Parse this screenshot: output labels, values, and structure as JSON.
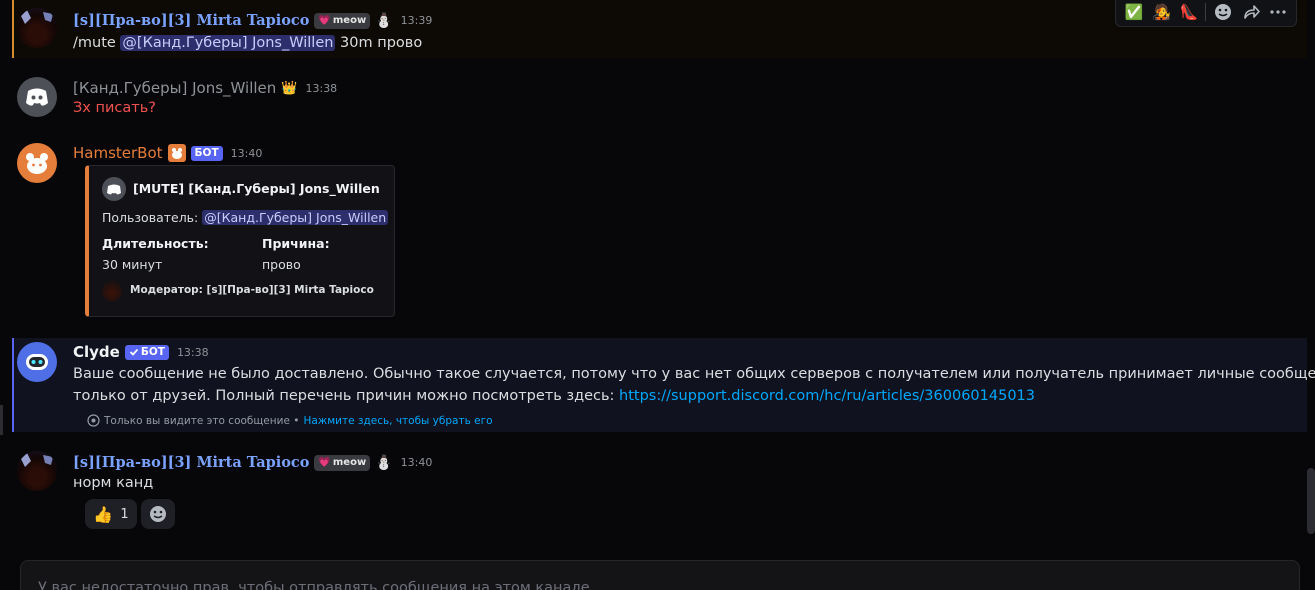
{
  "toolbar": {
    "reactions": [
      "✅",
      "🧑‍🎤",
      "👠"
    ],
    "icons": [
      "add-reaction-icon",
      "forward-icon",
      "more-icon"
    ]
  },
  "messages": {
    "m1": {
      "author": "[s][Пра-во][3] Mirta Tapioco",
      "badge": "meow",
      "badge_emoji": "💗",
      "extra_emoji": "⛄",
      "time": "13:39",
      "cmd": "/mute",
      "mention": "@[Канд.Губеры] Jons_Willen",
      "rest": "30m прово"
    },
    "m2": {
      "author": "[Канд.Губеры] Jons_Willen",
      "crown": "👑",
      "time": "13:38",
      "text": "Зх писать?"
    },
    "m3": {
      "author": "HamsterBot",
      "bot_tag": "БОТ",
      "time": "13:40",
      "embed": {
        "title": "[MUTE] [Канд.Губеры] Jons_Willen",
        "user_label": "Пользователь:",
        "user_mention": "@[Канд.Губеры] Jons_Willen",
        "duration_label": "Длительность:",
        "duration_value": "30 минут",
        "reason_label": "Причина:",
        "reason_value": "прово",
        "footer": "Модератор: [s][Пра-во][3] Mirta Tapioco"
      }
    },
    "m4": {
      "author": "Clyde",
      "bot_tag": "БОТ",
      "time": "13:38",
      "line1": "Ваше сообщение не было доставлено. Обычно такое случается, потому что у вас нет общих серверов с получателем или получатель принимает личные сообщения",
      "line2": "только от друзей. Полный перечень причин можно посмотреть здесь:",
      "link": "https://support.discord.com/hc/ru/articles/360060145013",
      "ephemeral_note": "Только вы видите это сообщение •",
      "dismiss": "Нажмите здесь, чтобы убрать его"
    },
    "m5": {
      "author": "[s][Пра-во][3] Mirta Tapioco",
      "badge": "meow",
      "badge_emoji": "💗",
      "extra_emoji": "⛄",
      "time": "13:40",
      "text": "норм канд",
      "reaction_emoji": "👍",
      "reaction_count": "1"
    }
  },
  "composer": {
    "placeholder": "У вас недостаточно прав, чтобы отправлять сообщения на этом канале."
  },
  "colors": {
    "mirta_name": "#7aa2ff",
    "hamster_orange": "#e67e3b",
    "error_red": "#f0524f",
    "link": "#00a8fc",
    "blurple": "#5865f2"
  }
}
